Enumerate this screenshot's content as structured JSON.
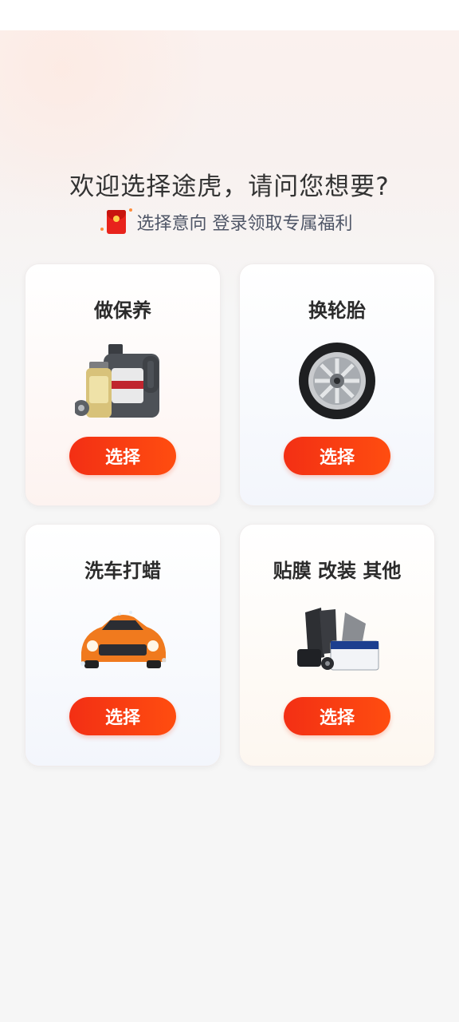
{
  "header": {
    "title": "欢迎选择途虎，请问您想要?",
    "subtitle": "选择意向 登录领取专属福利",
    "subtitle_icon": "red-packet-icon"
  },
  "cards": [
    {
      "title": "做保养",
      "button": "选择",
      "image": "engine-oil-image"
    },
    {
      "title": "换轮胎",
      "button": "选择",
      "image": "tire-image"
    },
    {
      "title": "洗车打蜡",
      "button": "选择",
      "image": "car-wash-image"
    },
    {
      "title": "贴膜 改装 其他",
      "button": "选择",
      "image": "accessories-image"
    }
  ],
  "colors": {
    "accent": "#f32f14",
    "background": "#f6f6f6"
  }
}
